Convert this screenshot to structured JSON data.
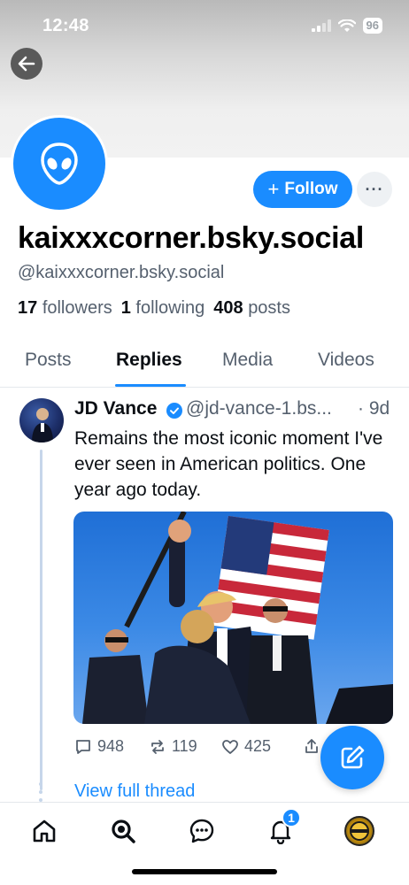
{
  "status_bar": {
    "time": "12:48",
    "battery": "96"
  },
  "profile": {
    "display_name": "kaixxxcorner.bsky.social",
    "handle": "@kaixxxcorner.bsky.social",
    "follow_label": "Follow",
    "more_label": "···",
    "stats": {
      "followers_count": "17",
      "followers_label": "followers",
      "following_count": "1",
      "following_label": "following",
      "posts_count": "408",
      "posts_label": "posts"
    }
  },
  "tabs": [
    {
      "label": "Posts"
    },
    {
      "label": "Replies",
      "active": true
    },
    {
      "label": "Media"
    },
    {
      "label": "Videos"
    }
  ],
  "post": {
    "author": "JD Vance",
    "handle": "@jd-vance-1.bs...",
    "time": "· 9d",
    "text": "Remains the most iconic moment I've ever seen in American politics. One year ago today.",
    "replies": "948",
    "reposts": "119",
    "likes": "425",
    "view_thread": "View full thread"
  },
  "tabbar": {
    "notifications_badge": "1"
  },
  "colors": {
    "accent": "#1a8cff",
    "muted_text": "#55606e",
    "thread_line": "#c6d6ea"
  }
}
